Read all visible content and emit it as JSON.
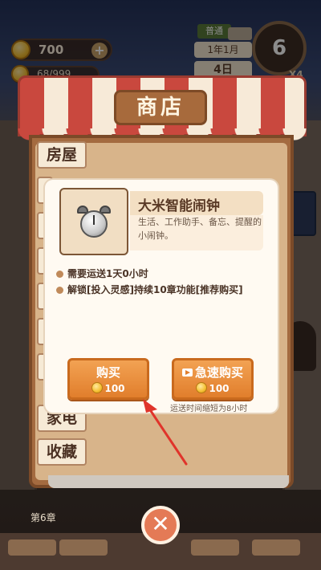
{
  "hud": {
    "coins": "700",
    "energy": "68/999",
    "season_tag": "普通",
    "date_month": "1年1月",
    "date_day": "4日",
    "speed": "6",
    "speed_multiplier": "X4"
  },
  "shop": {
    "title": "商店",
    "tabs": [
      "房屋",
      "家电",
      "收藏"
    ]
  },
  "item": {
    "name": "大米智能闹钟",
    "description": "生活、工作助手、备忘、提醒的小闹钟。",
    "requirements": [
      "需要运送1天0小时",
      "解锁[投入灵感]持续10章功能[推荐购买]"
    ],
    "buy_label": "购买",
    "buy_price": "100",
    "fast_buy_label": "急速购买",
    "fast_buy_price": "100",
    "fast_buy_hint": "运送时间缩短为8小时"
  },
  "footer": {
    "chapter": "第6章"
  },
  "colors": {
    "button": "#e17e2c",
    "awning_red": "#c9483e",
    "frame": "#a46b40",
    "annotation_arrow": "#e0342b"
  }
}
